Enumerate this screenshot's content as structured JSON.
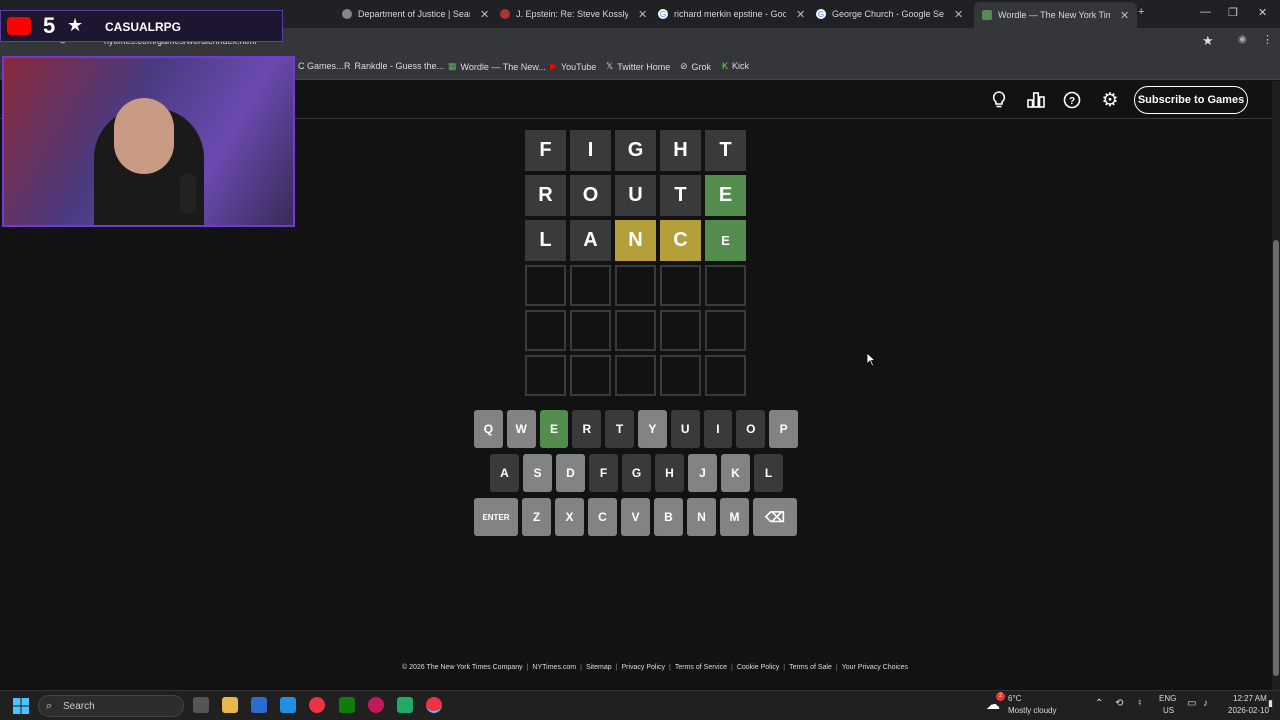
{
  "browser": {
    "tabs": [
      {
        "label": "Department of Justice | Search",
        "icon": "doj-icon"
      },
      {
        "label": "J. Epstein: Re: Steve Kosslyn —",
        "icon": "mail-icon"
      },
      {
        "label": "richard merkin epstine - Googl",
        "icon": "google-icon"
      },
      {
        "label": "George Church - Google Search",
        "icon": "google-icon"
      },
      {
        "label": "Wordle — The New York Times",
        "icon": "wordle-icon"
      }
    ],
    "url": "nytimes.com/games/wordle/index.html",
    "bookmarks": [
      {
        "label": "C Games..."
      },
      {
        "label": "Rankdle - Guess the..."
      },
      {
        "label": "Wordle — The New..."
      },
      {
        "label": "YouTube"
      },
      {
        "label": "Twitter Home"
      },
      {
        "label": "Grok"
      },
      {
        "label": "Kick"
      }
    ]
  },
  "stream_overlay": {
    "count": "5",
    "channel": "CASUALRPG"
  },
  "header": {
    "subscribe_label": "Subscribe to Games"
  },
  "board": {
    "rows": [
      {
        "tiles": [
          {
            "l": "F",
            "s": "absent"
          },
          {
            "l": "I",
            "s": "absent"
          },
          {
            "l": "G",
            "s": "absent"
          },
          {
            "l": "H",
            "s": "absent"
          },
          {
            "l": "T",
            "s": "absent"
          }
        ]
      },
      {
        "tiles": [
          {
            "l": "R",
            "s": "absent"
          },
          {
            "l": "O",
            "s": "absent"
          },
          {
            "l": "U",
            "s": "absent"
          },
          {
            "l": "T",
            "s": "absent"
          },
          {
            "l": "E",
            "s": "correct"
          }
        ]
      },
      {
        "tiles": [
          {
            "l": "L",
            "s": "absent"
          },
          {
            "l": "A",
            "s": "absent"
          },
          {
            "l": "N",
            "s": "present"
          },
          {
            "l": "C",
            "s": "present"
          },
          {
            "l": "E",
            "s": "tbd"
          }
        ]
      },
      {
        "tiles": [
          {
            "l": "",
            "s": "empty"
          },
          {
            "l": "",
            "s": "empty"
          },
          {
            "l": "",
            "s": "empty"
          },
          {
            "l": "",
            "s": "empty"
          },
          {
            "l": "",
            "s": "empty"
          }
        ]
      },
      {
        "tiles": [
          {
            "l": "",
            "s": "empty"
          },
          {
            "l": "",
            "s": "empty"
          },
          {
            "l": "",
            "s": "empty"
          },
          {
            "l": "",
            "s": "empty"
          },
          {
            "l": "",
            "s": "empty"
          }
        ]
      },
      {
        "tiles": [
          {
            "l": "",
            "s": "empty"
          },
          {
            "l": "",
            "s": "empty"
          },
          {
            "l": "",
            "s": "empty"
          },
          {
            "l": "",
            "s": "empty"
          },
          {
            "l": "",
            "s": "empty"
          }
        ]
      }
    ]
  },
  "keyboard": {
    "rows": [
      [
        {
          "k": "Q",
          "s": "unused"
        },
        {
          "k": "W",
          "s": "unused"
        },
        {
          "k": "E",
          "s": "correct"
        },
        {
          "k": "R",
          "s": "absent"
        },
        {
          "k": "T",
          "s": "absent"
        },
        {
          "k": "Y",
          "s": "unused"
        },
        {
          "k": "U",
          "s": "absent"
        },
        {
          "k": "I",
          "s": "absent"
        },
        {
          "k": "O",
          "s": "absent"
        },
        {
          "k": "P",
          "s": "unused"
        }
      ],
      [
        {
          "k": "A",
          "s": "absent"
        },
        {
          "k": "S",
          "s": "unused"
        },
        {
          "k": "D",
          "s": "unused"
        },
        {
          "k": "F",
          "s": "absent"
        },
        {
          "k": "G",
          "s": "absent"
        },
        {
          "k": "H",
          "s": "absent"
        },
        {
          "k": "J",
          "s": "unused"
        },
        {
          "k": "K",
          "s": "unused"
        },
        {
          "k": "L",
          "s": "absent"
        }
      ],
      [
        {
          "k": "ENTER",
          "s": "wide"
        },
        {
          "k": "Z",
          "s": "unused"
        },
        {
          "k": "X",
          "s": "unused"
        },
        {
          "k": "C",
          "s": "unused"
        },
        {
          "k": "V",
          "s": "unused"
        },
        {
          "k": "B",
          "s": "unused"
        },
        {
          "k": "N",
          "s": "unused"
        },
        {
          "k": "M",
          "s": "unused"
        },
        {
          "k": "⌫",
          "s": "wide"
        }
      ]
    ]
  },
  "footer": {
    "links": [
      "© 2026 The New York Times Company",
      "NYTimes.com",
      "Sitemap",
      "Privacy Policy",
      "Terms of Service",
      "Cookie Policy",
      "Terms of Sale",
      "Your Privacy Choices"
    ]
  },
  "taskbar": {
    "search_placeholder": "Search",
    "weather_temp": "6°C",
    "weather_desc": "Mostly cloudy",
    "lang_line1": "ENG",
    "lang_line2": "US",
    "time": "12:27 AM",
    "date": "2026-02-10",
    "notif_count": "2"
  },
  "colors": {
    "correct": "#538d4e",
    "present": "#b59f3b",
    "absent": "#3a3a3c",
    "unused": "#818384",
    "background": "#121213"
  }
}
